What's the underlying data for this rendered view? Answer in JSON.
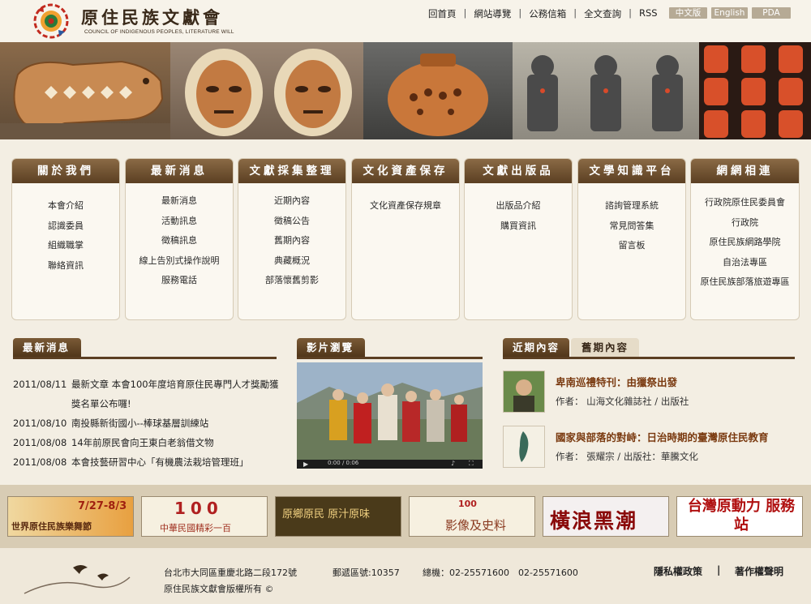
{
  "header": {
    "brand_cn": "原住民族文獻會",
    "brand_en": "COUNCIL OF INDIGENOUS PEOPLES, LITERATURE WILL",
    "nav": [
      "回首頁",
      "網站導覽",
      "公務信箱",
      "全文查詢",
      "RSS"
    ],
    "lang": [
      "中文版",
      "English",
      "PDA"
    ]
  },
  "menus": [
    {
      "title": "關於我們",
      "items": [
        "本會介紹",
        "認識委員",
        "組織職掌",
        "聯絡資訊"
      ]
    },
    {
      "title": "最新消息",
      "items": [
        "最新消息",
        "活動訊息",
        "徵稿訊息",
        "線上告別式操作說明",
        "服務電話"
      ]
    },
    {
      "title": "文獻採集整理",
      "items": [
        "近期內容",
        "徵稿公告",
        "舊期內容",
        "典藏概況",
        "部落懷舊剪影"
      ]
    },
    {
      "title": "文化資產保存",
      "items": [
        "文化資產保存規章"
      ]
    },
    {
      "title": "文獻出版品",
      "items": [
        "出版品介紹",
        "購買資訊"
      ]
    },
    {
      "title": "文學知識平台",
      "items": [
        "諮詢管理系統",
        "常見問答集",
        "留言板"
      ]
    },
    {
      "title": "網網相連",
      "items": [
        "行政院原住民委員會",
        "行政院",
        "原住民族網路學院",
        "自治法專區",
        "原住民族部落旅遊專區"
      ]
    }
  ],
  "news": {
    "title": "最新消息",
    "items": [
      {
        "date": "2011/08/11",
        "text": "最新文章 本會100年度培育原住民專門人才獎勵獲獎名單公布囉!"
      },
      {
        "date": "2011/08/10",
        "text": "南投縣新街國小--棒球基層訓練站"
      },
      {
        "date": "2011/08/08",
        "text": "14年前原民會向王東白老翁借文物"
      },
      {
        "date": "2011/08/08",
        "text": "本會技藝研習中心「有機農法栽培管理班」"
      }
    ]
  },
  "video": {
    "title": "影片瀏覽",
    "time": "0:00 / 0:06"
  },
  "recent": {
    "tabs": [
      "近期內容",
      "舊期內容"
    ],
    "items": [
      {
        "title": "卑南巡禮特刊：由獵祭出發",
        "meta": "作者： 山海文化雜誌社 / 出版社"
      },
      {
        "title": "國家與部落的對峙：日治時期的臺灣原住民教育",
        "meta": "作者： 張耀宗 / 出版社：華騰文化"
      }
    ]
  },
  "partners": [
    {
      "label": "世界原住民族樂舞節",
      "sub": "7/27-8/3"
    },
    {
      "label": "中華民國精彩一百",
      "sub": "100"
    },
    {
      "label": "原鄉原民 原汁原味",
      "sub": ""
    },
    {
      "label": "影像及史料",
      "sub": "100"
    },
    {
      "label": "橫浪黑潮",
      "sub": ""
    },
    {
      "label": "台灣原動力 服務站",
      "sub": ""
    }
  ],
  "footer": {
    "address": "台北市大同區重慶北路二段172號",
    "zip": "郵遞區號:10357",
    "phone": "總機：02-25571600　02-25571600",
    "copyright": "原住民族文獻會版權所有 ©",
    "links": [
      "隱私權政策",
      "著作權聲明"
    ]
  },
  "colors": {
    "brown_dark": "#5b3f22",
    "accent_red": "#7a3a10",
    "bg": "#f3eee3"
  }
}
